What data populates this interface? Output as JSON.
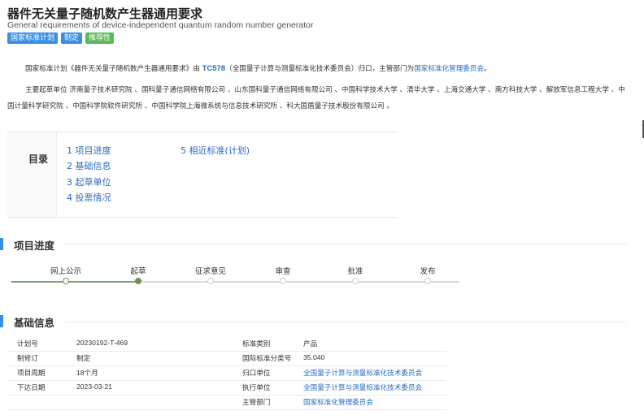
{
  "header": {
    "title": "器件无关量子随机数产生器通用要求",
    "subtitle": "General requirements of device-independent quantum random number generator",
    "tags": [
      "国家标准计划",
      "制定",
      "推荐性"
    ]
  },
  "intro": {
    "p1_a": "国家标准计划《器件无关量子随机数产生器通用要求》由 ",
    "p1_tc": "TC578",
    "p1_b": "（全国量子计算与测量标准化技术委员会）归口，主管部门为",
    "p1_dept": "国家标准化管理委员会",
    "p1_c": "。",
    "p2": "主要起草单位 济南量子技术研究院 、国科量子通信网络有限公司 、山东国科量子通信网络有限公司 、中国科学技术大学 、清华大学 、上海交通大学 、南方科技大学 、解放军信息工程大学 、中国计量科学研究院 、中国科学院软件研究所 、中国科学院上海微系统与信息技术研究所 、科大国盾量子技术股份有限公司 。"
  },
  "toc": {
    "title": "目录",
    "items": [
      "1 项目进度",
      "2 基础信息",
      "3 起草单位",
      "4 投票情况",
      "5 相近标准(计划)"
    ]
  },
  "progress": {
    "title": "项目进度",
    "steps": [
      {
        "label": "网上公示",
        "state": "done"
      },
      {
        "label": "起草",
        "state": "current"
      },
      {
        "label": "征求意见",
        "state": "todo"
      },
      {
        "label": "审查",
        "state": "todo"
      },
      {
        "label": "批准",
        "state": "todo"
      },
      {
        "label": "发布",
        "state": "todo"
      }
    ]
  },
  "basic": {
    "title": "基础信息",
    "rows": [
      {
        "l1": "计划号",
        "v1": "20230192-T-469",
        "l2": "标准类别",
        "v2": "产品"
      },
      {
        "l1": "制修订",
        "v1": "制定",
        "l2": "国际标准分类号",
        "v2": "35.040"
      },
      {
        "l1": "项目周期",
        "v1": "18个月",
        "l2": "归口单位",
        "v2": "全国量子计算与测量标准化技术委员会"
      },
      {
        "l1": "下达日期",
        "v1": "2023-03-21",
        "l2": "执行单位",
        "v2": "全国量子计算与测量标准化技术委员会"
      },
      {
        "l1": "",
        "v1": "",
        "l2": "主管部门",
        "v2": "国家标准化管理委员会"
      }
    ]
  },
  "colors": {
    "accent": "#3a8ee6",
    "link": "#2b6cc4",
    "progress_done": "#6f9159",
    "tag_green": "#5cb85c"
  }
}
